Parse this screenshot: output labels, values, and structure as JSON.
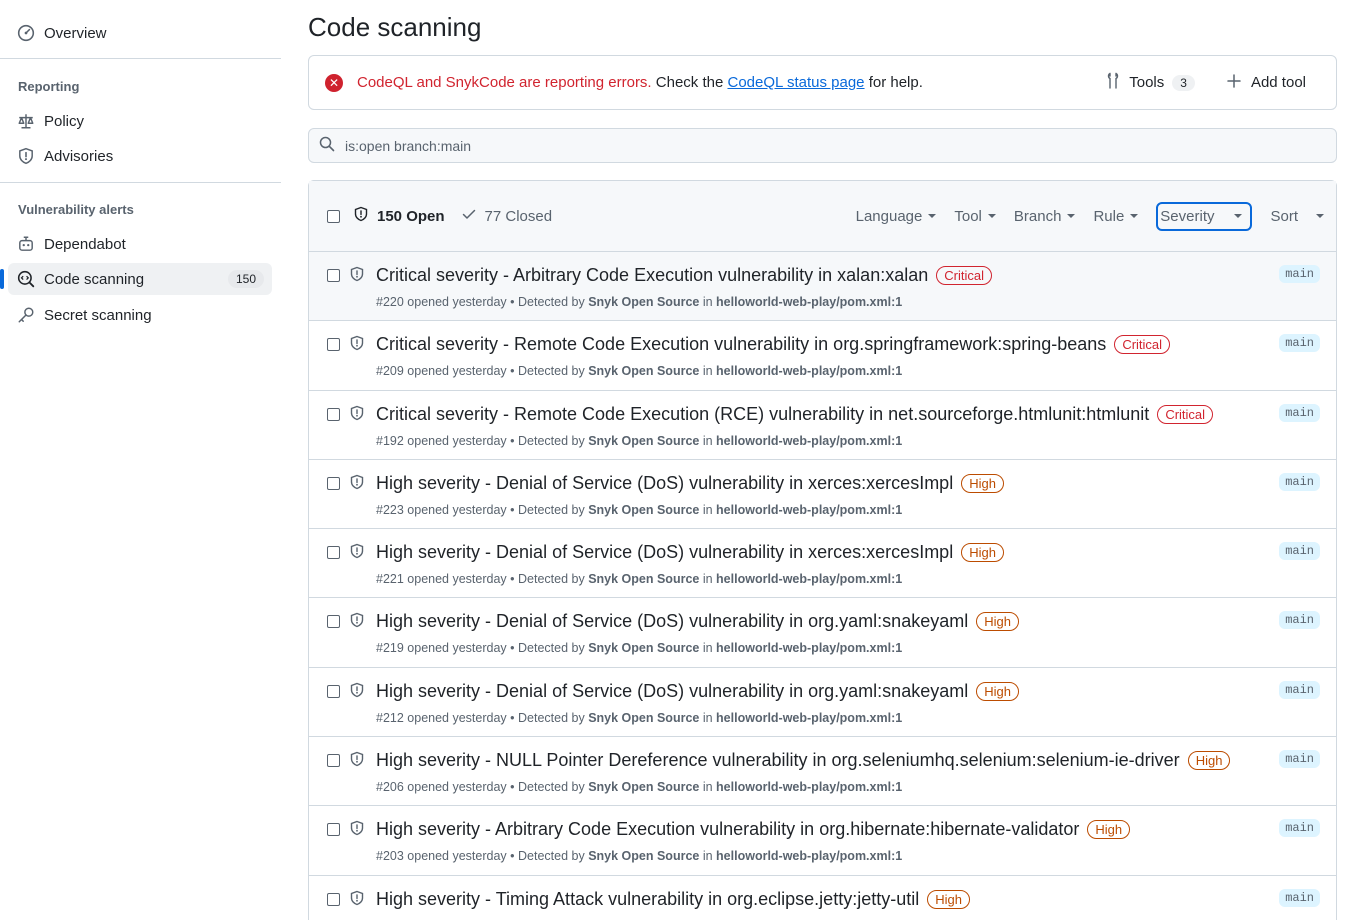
{
  "sidebar": {
    "overview": "Overview",
    "reporting_heading": "Reporting",
    "policy": "Policy",
    "advisories": "Advisories",
    "alerts_heading": "Vulnerability alerts",
    "dependabot": "Dependabot",
    "code_scanning": "Code scanning",
    "code_scanning_count": "150",
    "secret_scanning": "Secret scanning"
  },
  "page": {
    "title": "Code scanning"
  },
  "banner": {
    "error_text": "CodeQL and SnykCode are reporting errors.",
    "check_text": " Check the ",
    "link_text": "CodeQL status page",
    "help_text": " for help.",
    "tools_label": "Tools",
    "tools_count": "3",
    "add_tool_label": "Add tool"
  },
  "search": {
    "value": "is:open branch:main"
  },
  "table_header": {
    "open_label": "150 Open",
    "closed_label": "77 Closed",
    "filters": {
      "language": "Language",
      "tool": "Tool",
      "branch": "Branch",
      "rule": "Rule",
      "severity": "Severity",
      "sort": "Sort"
    }
  },
  "alerts": [
    {
      "title": "Critical severity - Arbitrary Code Execution vulnerability in xalan:xalan",
      "severity": "Critical",
      "number": "#220",
      "opened": "opened yesterday",
      "tool": "Snyk Open Source",
      "file": "helloworld-web-play/pom.xml:1",
      "branch": "main"
    },
    {
      "title": "Critical severity - Remote Code Execution vulnerability in org.springframework:spring-beans",
      "severity": "Critical",
      "number": "#209",
      "opened": "opened yesterday",
      "tool": "Snyk Open Source",
      "file": "helloworld-web-play/pom.xml:1",
      "branch": "main"
    },
    {
      "title": "Critical severity - Remote Code Execution (RCE) vulnerability in net.sourceforge.htmlunit:htmlunit",
      "severity": "Critical",
      "number": "#192",
      "opened": "opened yesterday",
      "tool": "Snyk Open Source",
      "file": "helloworld-web-play/pom.xml:1",
      "branch": "main"
    },
    {
      "title": "High severity - Denial of Service (DoS) vulnerability in xerces:xercesImpl",
      "severity": "High",
      "number": "#223",
      "opened": "opened yesterday",
      "tool": "Snyk Open Source",
      "file": "helloworld-web-play/pom.xml:1",
      "branch": "main"
    },
    {
      "title": "High severity - Denial of Service (DoS) vulnerability in xerces:xercesImpl",
      "severity": "High",
      "number": "#221",
      "opened": "opened yesterday",
      "tool": "Snyk Open Source",
      "file": "helloworld-web-play/pom.xml:1",
      "branch": "main"
    },
    {
      "title": "High severity - Denial of Service (DoS) vulnerability in org.yaml:snakeyaml",
      "severity": "High",
      "number": "#219",
      "opened": "opened yesterday",
      "tool": "Snyk Open Source",
      "file": "helloworld-web-play/pom.xml:1",
      "branch": "main"
    },
    {
      "title": "High severity - Denial of Service (DoS) vulnerability in org.yaml:snakeyaml",
      "severity": "High",
      "number": "#212",
      "opened": "opened yesterday",
      "tool": "Snyk Open Source",
      "file": "helloworld-web-play/pom.xml:1",
      "branch": "main"
    },
    {
      "title": "High severity - NULL Pointer Dereference vulnerability in org.seleniumhq.selenium:selenium-ie-driver",
      "severity": "High",
      "number": "#206",
      "opened": "opened yesterday",
      "tool": "Snyk Open Source",
      "file": "helloworld-web-play/pom.xml:1",
      "branch": "main"
    },
    {
      "title": "High severity - Arbitrary Code Execution vulnerability in org.hibernate:hibernate-validator",
      "severity": "High",
      "number": "#203",
      "opened": "opened yesterday",
      "tool": "Snyk Open Source",
      "file": "helloworld-web-play/pom.xml:1",
      "branch": "main"
    },
    {
      "title": "High severity - Timing Attack vulnerability in org.eclipse.jetty:jetty-util",
      "severity": "High",
      "number": "",
      "opened": "",
      "tool": "",
      "file": "",
      "branch": "main"
    }
  ],
  "meta_words": {
    "bullet": " • Detected by ",
    "in": " in "
  },
  "colors": {
    "accent": "#0969da",
    "critical": "#d1242f",
    "high": "#bc4c00",
    "error": "#cf222e"
  }
}
